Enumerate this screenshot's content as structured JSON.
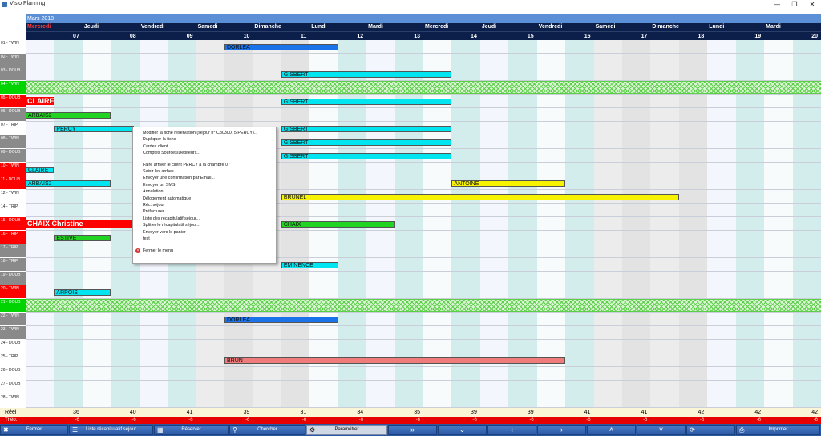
{
  "window": {
    "title": "Visio Planning",
    "minimize": "—",
    "restore": "❐",
    "close": "✕"
  },
  "month_label": "Mars 2018",
  "days": [
    {
      "name": "Mercredi",
      "num": "07",
      "weekend": false
    },
    {
      "name": "Jeudi",
      "num": "08",
      "weekend": false
    },
    {
      "name": "Vendredi",
      "num": "09",
      "weekend": false
    },
    {
      "name": "Samedi",
      "num": "10",
      "weekend": true
    },
    {
      "name": "Dimanche",
      "num": "11",
      "weekend": true
    },
    {
      "name": "Lundi",
      "num": "12",
      "weekend": false
    },
    {
      "name": "Mardi",
      "num": "13",
      "weekend": false
    },
    {
      "name": "Mercredi",
      "num": "14",
      "weekend": false
    },
    {
      "name": "Jeudi",
      "num": "15",
      "weekend": false
    },
    {
      "name": "Vendredi",
      "num": "16",
      "weekend": false
    },
    {
      "name": "Samedi",
      "num": "17",
      "weekend": true
    },
    {
      "name": "Dimanche",
      "num": "18",
      "weekend": true
    },
    {
      "name": "Lundi",
      "num": "19",
      "weekend": false
    },
    {
      "name": "Mardi",
      "num": "20",
      "weekend": false
    }
  ],
  "colors": {
    "room_clean": "#ffffff",
    "room_grey": "#8a8a8a",
    "room_red": "#ff0000",
    "room_green": "#00d400",
    "resa_cyan": "#00e5f0",
    "resa_blue": "#1a73e8",
    "resa_yellow": "#f7f200",
    "resa_green": "#22d422",
    "resa_salmon": "#f07b7b",
    "resa_red": "#ff0000"
  },
  "rooms": [
    {
      "label": "01 - TWIN",
      "status": "clean"
    },
    {
      "label": "02 - TWIN",
      "status": "grey"
    },
    {
      "label": "03 - DOUB",
      "status": "grey"
    },
    {
      "label": "04 - TWIN",
      "status": "green"
    },
    {
      "label": "05 - DOUB",
      "status": "red"
    },
    {
      "label": "06 - DOUB",
      "status": "grey"
    },
    {
      "label": "07 - TRIP",
      "status": "clean"
    },
    {
      "label": "08 - TWIN",
      "status": "grey"
    },
    {
      "label": "09 - DOUB",
      "status": "grey"
    },
    {
      "label": "10 - TWIN",
      "status": "red"
    },
    {
      "label": "11 - DOUB",
      "status": "red"
    },
    {
      "label": "12 - TWIN",
      "status": "clean"
    },
    {
      "label": "14 - TRIP",
      "status": "clean"
    },
    {
      "label": "15 - DOUB",
      "status": "red"
    },
    {
      "label": "16 - TRIP",
      "status": "red"
    },
    {
      "label": "17 - TRIP",
      "status": "grey"
    },
    {
      "label": "18 - TRIP",
      "status": "grey"
    },
    {
      "label": "19 - DOUB",
      "status": "grey"
    },
    {
      "label": "20 - TWIN",
      "status": "red"
    },
    {
      "label": "21 - DOUB",
      "status": "green"
    },
    {
      "label": "22 - TWIN",
      "status": "grey"
    },
    {
      "label": "23 - TWIN",
      "status": "grey"
    },
    {
      "label": "24 - DOUB",
      "status": "clean"
    },
    {
      "label": "25 - TRIP",
      "status": "clean"
    },
    {
      "label": "26 - DOUB",
      "status": "clean"
    },
    {
      "label": "27 - DOUB",
      "status": "clean"
    },
    {
      "label": "28 - TWIN",
      "status": "clean"
    }
  ],
  "blocked_rows": [
    3,
    19
  ],
  "reservations": [
    {
      "name": "DORLEA",
      "row": 0,
      "start": 3.5,
      "end": 5.5,
      "color": "resa_blue",
      "big": false
    },
    {
      "name": "GISBERT",
      "row": 2,
      "start": 4.5,
      "end": 7.5,
      "color": "resa_cyan",
      "big": false
    },
    {
      "name": "CLAIRE",
      "row": 4,
      "start": 0,
      "end": 0.5,
      "color": "resa_red",
      "big": true
    },
    {
      "name": "GISBERT",
      "row": 4,
      "start": 4.5,
      "end": 7.5,
      "color": "resa_cyan",
      "big": false
    },
    {
      "name": "ARBAIS2",
      "row": 5,
      "start": 0,
      "end": 1.5,
      "color": "resa_green",
      "big": false
    },
    {
      "name": "PERCY",
      "row": 6,
      "start": 0.5,
      "end": 1.9,
      "color": "resa_cyan",
      "big": false
    },
    {
      "name": "GISBERT",
      "row": 6,
      "start": 4.5,
      "end": 7.5,
      "color": "resa_cyan",
      "big": false
    },
    {
      "name": "GISBERT",
      "row": 7,
      "start": 4.5,
      "end": 7.5,
      "color": "resa_cyan",
      "big": false
    },
    {
      "name": "GISBERT",
      "row": 8,
      "start": 4.5,
      "end": 7.5,
      "color": "resa_cyan",
      "big": false
    },
    {
      "name": "CLAIRE",
      "row": 9,
      "start": 0,
      "end": 0.5,
      "color": "resa_cyan",
      "big": false
    },
    {
      "name": "ARBAIS2",
      "row": 10,
      "start": 0,
      "end": 1.5,
      "color": "resa_cyan",
      "big": false
    },
    {
      "name": "ANTOINE",
      "row": 10,
      "start": 7.5,
      "end": 9.5,
      "color": "resa_yellow",
      "big": false
    },
    {
      "name": "BRUNEL",
      "row": 11,
      "start": 4.5,
      "end": 11.5,
      "color": "resa_yellow",
      "big": false
    },
    {
      "name": "CHAIX Christine",
      "row": 13,
      "start": 0,
      "end": 1.9,
      "color": "resa_red",
      "big": true
    },
    {
      "name": "CHAIX",
      "row": 13,
      "start": 4.5,
      "end": 6.5,
      "color": "resa_green",
      "big": false
    },
    {
      "name": "ESTIVE",
      "row": 14,
      "start": 0.5,
      "end": 1.5,
      "color": "resa_green",
      "big": false
    },
    {
      "name": "EMINENCE",
      "row": 16,
      "start": 4.5,
      "end": 5.5,
      "color": "resa_cyan",
      "big": false
    },
    {
      "name": "ARPOIS",
      "row": 18,
      "start": 0.5,
      "end": 1.5,
      "color": "resa_cyan",
      "big": false
    },
    {
      "name": "DORLEA",
      "row": 20,
      "start": 3.5,
      "end": 5.5,
      "color": "resa_blue",
      "big": false
    },
    {
      "name": "BRUN",
      "row": 23,
      "start": 3.5,
      "end": 9.5,
      "color": "resa_salmon",
      "big": false
    }
  ],
  "context_menu": {
    "groups": [
      [
        "Modifier la fiche réservation (séjour n° C8030075 PERCY)...",
        "Dupliquer la fiche",
        "Cardex client...",
        "Comptes Sources/Débiteurs..."
      ],
      [
        "Faire arriver le client PERCY à la chambre 07",
        "Saisir les arrhes",
        "Envoyer une confirmation par Email...",
        "Envoyer un SMS",
        "Annulation...",
        "Délogement automatique",
        "Réc. séjour",
        "Préfacturer...",
        "Liste des récapitulatif séjour...",
        "Splitter le récapitulatif séjour...",
        "Envoyer vers le panier",
        "test"
      ]
    ],
    "close_label": "Fermer le menu"
  },
  "totals": {
    "reel_label": "Réel",
    "theo_label": "Théo.",
    "reel": [
      "36",
      "40",
      "41",
      "39",
      "31",
      "34",
      "35",
      "39",
      "39",
      "41",
      "41",
      "42",
      "42",
      "42"
    ],
    "theo": [
      "-6",
      "-6",
      "-6",
      "-6",
      "-6",
      "-6",
      "-6",
      "-6",
      "-6",
      "-6",
      "-6",
      "-6",
      "-6",
      "-6"
    ]
  },
  "toolbar": [
    {
      "label": "Fermer",
      "icon": "close-icon",
      "glyph": "✖",
      "w": 86
    },
    {
      "label": "Liste récapitulatif séjour",
      "icon": "list-icon",
      "glyph": "☰",
      "w": 106
    },
    {
      "label": "Réserver",
      "icon": "calendar-icon",
      "glyph": "▦",
      "w": 94
    },
    {
      "label": "Chercher",
      "icon": "search-icon",
      "glyph": "⚲",
      "w": 96
    },
    {
      "label": "Paramétrer",
      "icon": "settings-icon",
      "glyph": "⚙",
      "w": 102,
      "pressed": true
    },
    {
      "label": "»",
      "icon": "fast-forward-icon",
      "glyph": "",
      "w": 62
    },
    {
      "label": "⌄",
      "icon": "chevron-double-down-icon",
      "glyph": "",
      "w": 62
    },
    {
      "label": "‹",
      "icon": "chevron-left-icon",
      "glyph": "",
      "w": 62
    },
    {
      "label": "›",
      "icon": "chevron-right-icon",
      "glyph": "",
      "w": 62
    },
    {
      "label": "˄",
      "icon": "chevron-up-icon",
      "glyph": "",
      "w": 62
    },
    {
      "label": "˅",
      "icon": "chevron-down-icon",
      "glyph": "",
      "w": 62
    },
    {
      "label": "",
      "icon": "refresh-icon",
      "glyph": "⟳",
      "w": 62
    },
    {
      "label": "Imprimer",
      "icon": "print-icon",
      "glyph": "⎙",
      "w": 106
    }
  ]
}
